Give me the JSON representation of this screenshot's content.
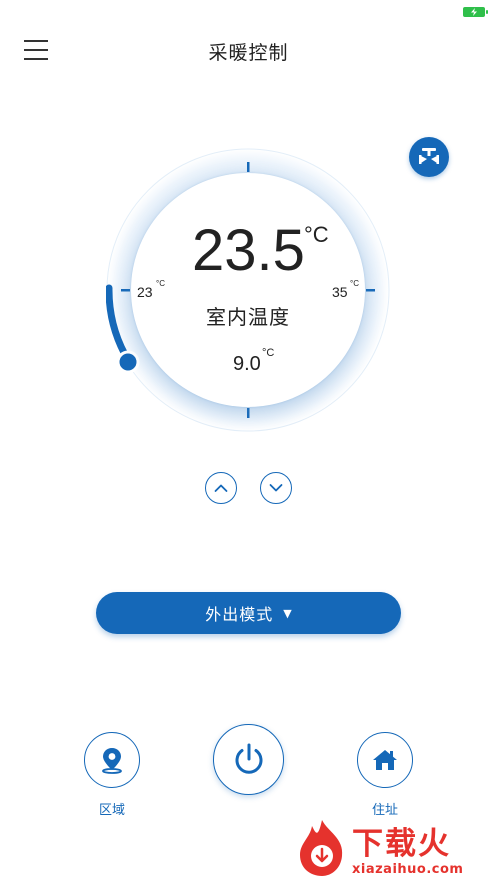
{
  "header": {
    "title": "采暖控制"
  },
  "dial": {
    "current_temp": "23.5",
    "current_unit": "°C",
    "current_label": "室内温度",
    "set_temp": "9.0",
    "set_unit": "°C",
    "min_temp": "23",
    "min_unit": "°C",
    "max_temp": "35",
    "max_unit": "°C"
  },
  "mode": {
    "label": "外出模式",
    "caret": "▼"
  },
  "bottom_nav": {
    "region_label": "区域",
    "home_label": "住址"
  },
  "watermark": {
    "text": "下载火",
    "url": "xiazaihuo.com"
  },
  "icons": {
    "menu": "menu-icon",
    "valve": "valve-icon",
    "up": "chevron-up-icon",
    "down": "chevron-down-icon",
    "region": "location-pin-icon",
    "power": "power-icon",
    "home": "home-icon"
  },
  "colors": {
    "accent": "#1568b8",
    "battery": "#2fbf4a",
    "watermark": "#e5322d"
  }
}
